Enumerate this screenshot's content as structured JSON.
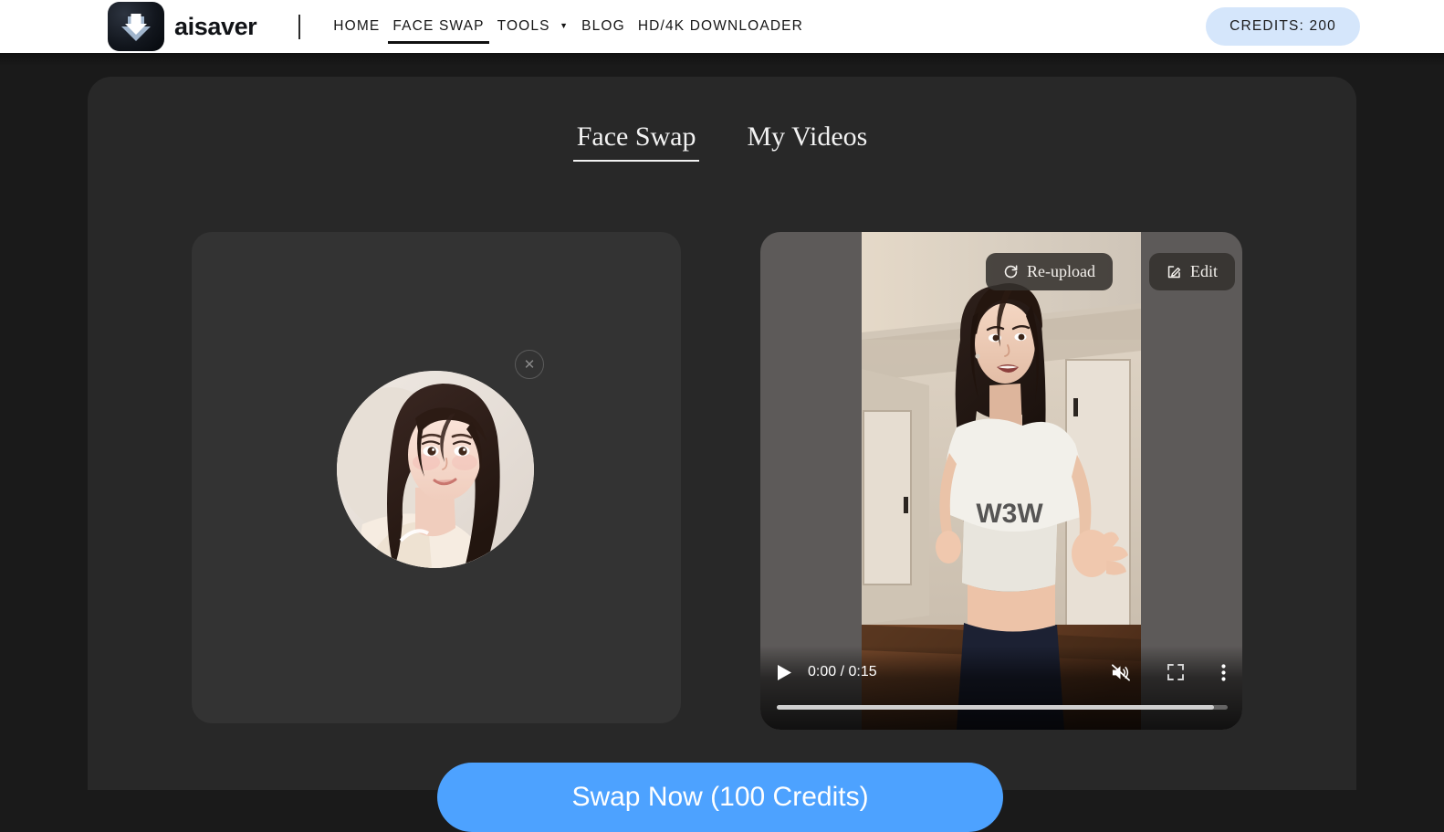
{
  "header": {
    "logo_text": "aisaver",
    "logo_icon": "download-arrow-icon",
    "nav": [
      {
        "label": "HOME",
        "active": false,
        "caret": false
      },
      {
        "label": "FACE SWAP",
        "active": true,
        "caret": false
      },
      {
        "label": "TOOLS",
        "active": false,
        "caret": true
      },
      {
        "label": "BLOG",
        "active": false,
        "caret": false
      },
      {
        "label": "HD/4K DOWNLOADER",
        "active": false,
        "caret": false
      }
    ],
    "caret_glyph": "▼",
    "credits_label": "CREDITS: 200",
    "credits_bg": "#d5e6fb"
  },
  "tabs": [
    {
      "label": "Face Swap",
      "active": true
    },
    {
      "label": "My Videos",
      "active": false
    }
  ],
  "face_panel": {
    "remove_icon": "close-circle-icon",
    "remove_glyph": "✕",
    "photo_alt": "uploaded-face-photo"
  },
  "video_panel": {
    "reupload_label": "Re-upload",
    "reupload_icon": "refresh-icon",
    "edit_label": "Edit",
    "edit_icon": "pencil-square-icon",
    "controls": {
      "play_icon": "play-icon",
      "time_label": "0:00 / 0:15",
      "mute_icon": "volume-muted-icon",
      "fullscreen_icon": "fullscreen-icon",
      "more_icon": "kebab-menu-icon"
    }
  },
  "action": {
    "swap_label": "Swap Now (100 Credits)",
    "swap_color": "#4da2ff"
  }
}
